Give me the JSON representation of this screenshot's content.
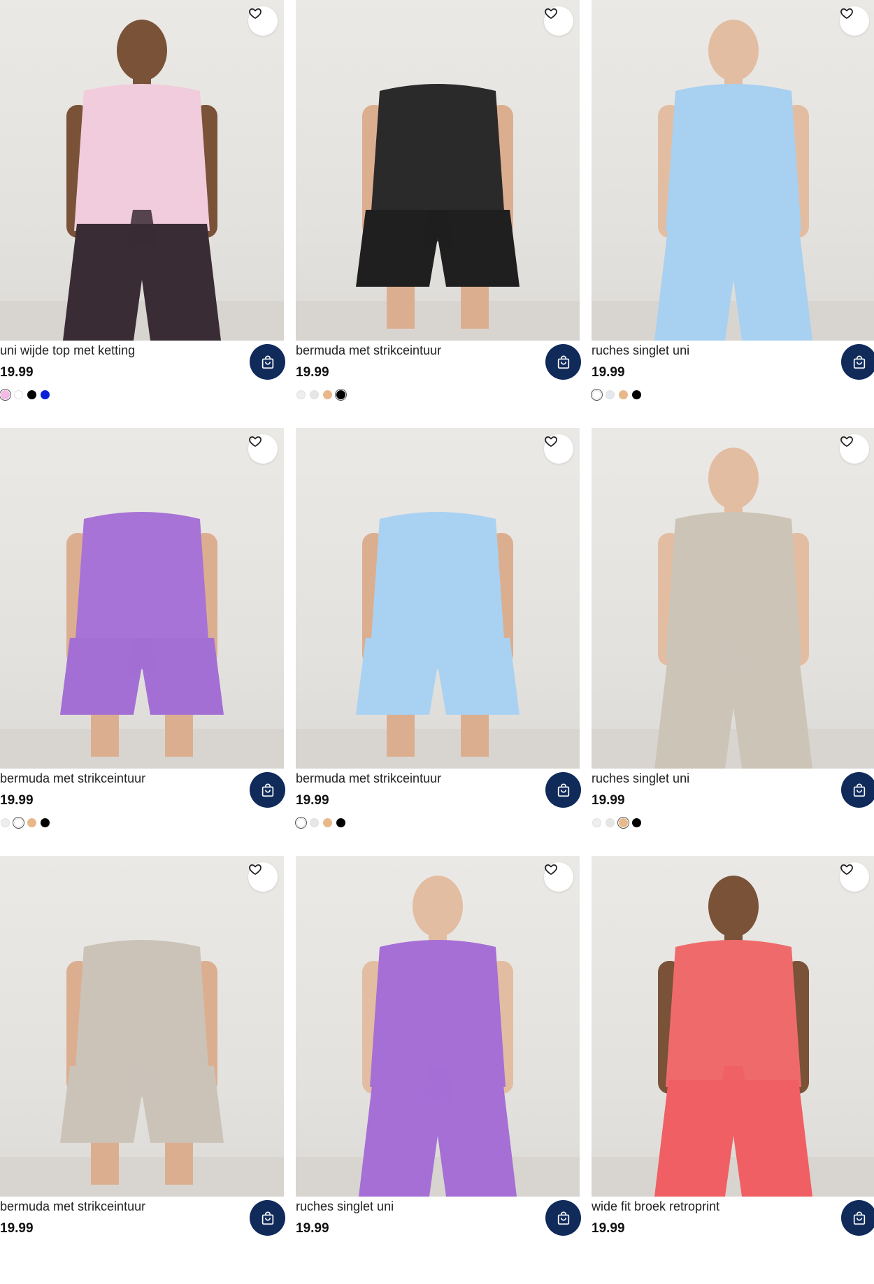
{
  "products": [
    {
      "name": "uni wijde top met ketting",
      "price": "19.99",
      "swatches": [
        "#f4b8e4",
        "#ffffff",
        "#000000",
        "#0a1fd8"
      ],
      "selected": 0,
      "image": {
        "top": "#f1ccdc",
        "bottom": "#3a2c34",
        "skin": "#7a5238"
      }
    },
    {
      "name": "bermuda met strikceintuur",
      "price": "19.99",
      "swatches": [
        "#eeeeee",
        "#e6e6e6",
        "#e8b88a",
        "#000000"
      ],
      "selected": 3,
      "image": {
        "top": "#2a2a2a",
        "bottom": "#1f1f1f",
        "skin": "#dcae90"
      }
    },
    {
      "name": "ruches singlet uni",
      "price": "19.99",
      "swatches": [
        "#ffffff",
        "#e5e8f0",
        "#e8b88a",
        "#000000"
      ],
      "selected": 0,
      "image": {
        "top": "#a8d0f0",
        "bottom": "#a8d0f0",
        "skin": "#e2bda2"
      }
    },
    {
      "name": "bermuda met strikceintuur",
      "price": "19.99",
      "swatches": [
        "#eeeeee",
        "#ffffff",
        "#e8b88a",
        "#000000"
      ],
      "selected": 1,
      "image": {
        "top": "#a873d6",
        "bottom": "#a36fd4",
        "skin": "#dcae90"
      }
    },
    {
      "name": "bermuda met strikceintuur",
      "price": "19.99",
      "swatches": [
        "#ffffff",
        "#e6e6e6",
        "#e8b88a",
        "#000000"
      ],
      "selected": 0,
      "image": {
        "top": "#a9d2f2",
        "bottom": "#a9d2f2",
        "skin": "#dcae90"
      }
    },
    {
      "name": "ruches singlet uni",
      "price": "19.99",
      "swatches": [
        "#eeeeee",
        "#e6e6e6",
        "#e8b88a",
        "#000000"
      ],
      "selected": 2,
      "image": {
        "top": "#cdc4b8",
        "bottom": "#cdc4b8",
        "skin": "#e2bda2"
      }
    },
    {
      "name": "bermuda met strikceintuur",
      "price": "19.99",
      "swatches": [],
      "selected": -1,
      "image": {
        "top": "#cbc3b8",
        "bottom": "#cbc3b8",
        "skin": "#dcae90"
      }
    },
    {
      "name": "ruches singlet uni",
      "price": "19.99",
      "swatches": [],
      "selected": -1,
      "image": {
        "top": "#a56fd6",
        "bottom": "#a56fd6",
        "skin": "#e2bda2"
      }
    },
    {
      "name": "wide fit broek retroprint",
      "price": "19.99",
      "swatches": [],
      "selected": -1,
      "image": {
        "top": "#ef6b6b",
        "bottom": "#ef5f63",
        "skin": "#7a5238"
      }
    }
  ],
  "icons": {
    "favorite": "heart-icon",
    "cart": "shopping-bag-icon"
  }
}
